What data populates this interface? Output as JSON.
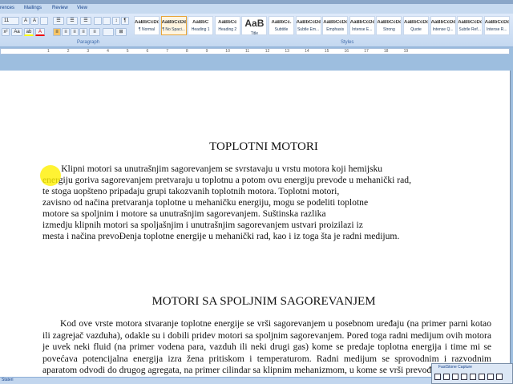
{
  "tabs": [
    "rences",
    "Mailings",
    "Review",
    "View"
  ],
  "ribbon": {
    "font_size": "11",
    "paragraph_label": "Paragraph",
    "styles_label": "Styles",
    "styles": [
      {
        "sample": "AaBbCcDd",
        "name": "¶ Normal"
      },
      {
        "sample": "AaBbCcDd",
        "name": "¶ No Spaci...",
        "selected": true
      },
      {
        "sample": "AaBbC",
        "name": "Heading 1"
      },
      {
        "sample": "AaBbCc",
        "name": "Heading 2"
      },
      {
        "sample": "AaB",
        "name": "Title"
      },
      {
        "sample": "AaBbCc.",
        "name": "Subtitle"
      },
      {
        "sample": "AaBbCcDd",
        "name": "Subtle Em..."
      },
      {
        "sample": "AaBbCcDd",
        "name": "Emphasis"
      },
      {
        "sample": "AaBbCcDd",
        "name": "Intense E..."
      },
      {
        "sample": "AaBbCcDd",
        "name": "Strong"
      },
      {
        "sample": "AaBbCcDd",
        "name": "Quote"
      },
      {
        "sample": "AaBbCcDd",
        "name": "Intense Q..."
      },
      {
        "sample": "AaBbCcDd",
        "name": "Subtle Ref..."
      },
      {
        "sample": "AaBbCcDd",
        "name": "Intense R..."
      }
    ]
  },
  "ruler": [
    "1",
    "2",
    "3",
    "4",
    "5",
    "6",
    "7",
    "8",
    "9",
    "10",
    "11",
    "12",
    "13",
    "14",
    "15",
    "16",
    "17",
    "18",
    "19"
  ],
  "document": {
    "title1": "TOPLOTNI MOTORI",
    "para1": [
      "        Klipni motori sa unutrašnjim sagorevanjem se svrstavaju u vrstu motora koji hemijsku",
      "energiju goriva sagorevanjem pretvaraju u toplotnu a potom ovu energiju prevode u mehanički rad,",
      "te stoga uopšteno pripadaju grupi takozvanih toplotnih motora. Toplotni motori,",
      "zavisno od načina pretvaranja toplotne u mehaničku energiju, mogu se podeliti toplotne",
      "motore sa spoljnim i motore sa unutrašnjim sagorevanjem. Suštinska razlika",
      "izmedju klipnih motori sa spoljašnjim i unutrašnjim sagorevanjem ustvari proizilazi iz",
      "mesta i načina prevoĐenja toplotne energije u mehanički rad, kao i iz toga šta je radni medijum."
    ],
    "title2": "MOTORI SA SPOLJNIM SAGOREVANJEM",
    "para2": "Kod ove vrste motora stvaranje toplotne energije se vrši sagorevanjem u posebnom uređaju (na primer parni kotao ili zagrejač vazduha), odakle su i dobili pridev motori sa spoljnim sagorevanjem. Pored toga radni medijum ovih motora je uvek neki fluid (na primer vodena para, vazduh ili neki drugi gas) kome se predaje toplotna energija i time mi se povećava potencijalna energija izra žena pritiskom i temperaturom. Radni medijum se sprovodnim i razvodnim aparatom odvodi do drugog agregata, na primer cilindar sa klipnim mehanizmom, u kome se vrši prevođenje ovih oblika energije u mehanički rad. Tipičan primer ovih motora je parna mašina, kao prvo"
  },
  "status": "Stateri",
  "faststone": {
    "title": "FastStone Capture"
  }
}
